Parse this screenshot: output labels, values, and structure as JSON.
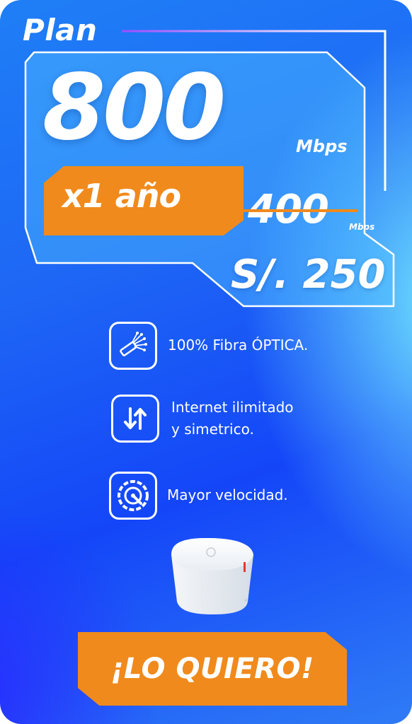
{
  "plan": {
    "title": "Plan",
    "speed": "800",
    "speed_unit": "Mbps",
    "duration_badge": "x1 año",
    "previous_speed": "400",
    "previous_speed_unit": "Mbps",
    "price": "S/. 250"
  },
  "features": [
    {
      "icon": "fiber-optic-icon",
      "lines": [
        "100% Fibra ÓPTICA."
      ]
    },
    {
      "icon": "upload-download-arrows-icon",
      "lines": [
        "Internet ilimitado",
        "y simetrico."
      ]
    },
    {
      "icon": "speedometer-icon",
      "lines": [
        "Mayor velocidad."
      ]
    }
  ],
  "cta": {
    "label": "¡LO QUIERO!"
  },
  "colors": {
    "accent": "#f08a1c",
    "background": "#1e66f5",
    "neon": "#8a5cff",
    "text": "#ffffff"
  }
}
